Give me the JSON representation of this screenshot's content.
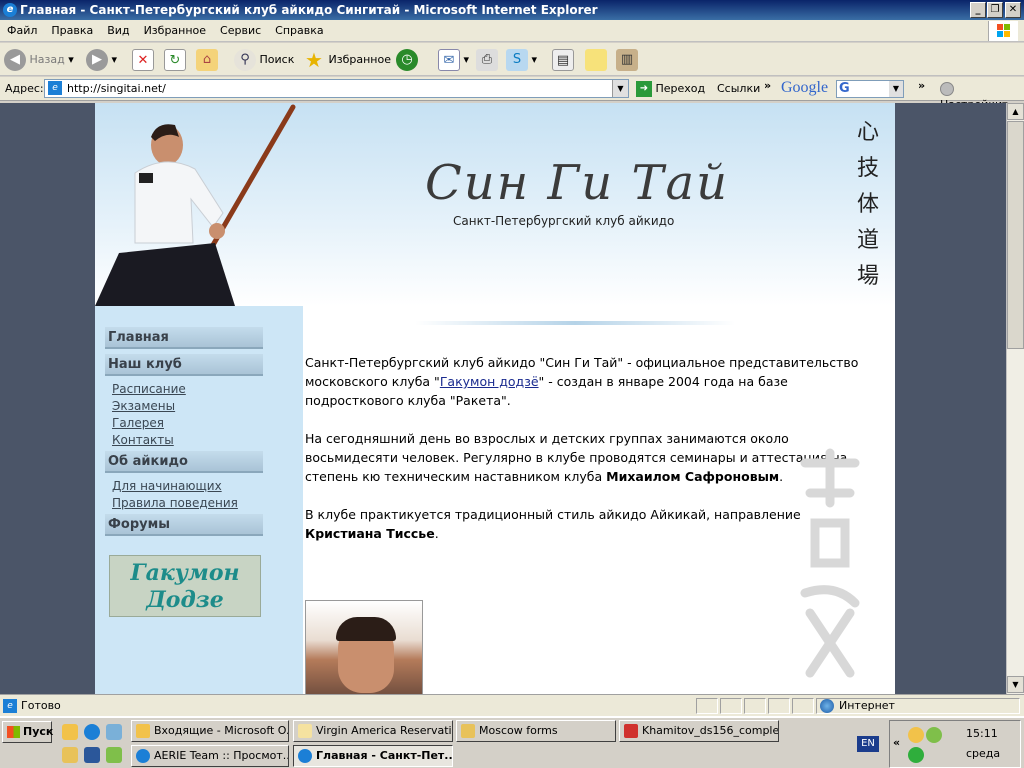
{
  "window": {
    "title": "Главная - Санкт-Петербургский клуб айкидо Сингитай - Microsoft Internet Explorer"
  },
  "menu": [
    "Файл",
    "Правка",
    "Вид",
    "Избранное",
    "Сервис",
    "Справка"
  ],
  "toolbar": {
    "back": "Назад",
    "search": "Поиск",
    "favorites": "Избранное"
  },
  "address": {
    "label": "Адрес:",
    "url": "http://singitai.net/",
    "go": "Переход",
    "links": "Ссылки",
    "google": "Google",
    "settings": "Настройки"
  },
  "site": {
    "logo": "Син Ги Тай",
    "subtitle": "Санкт-Петербургский клуб айкидо",
    "kanji": [
      "心",
      "技",
      "体",
      "道",
      "場"
    ],
    "nav": {
      "home": "Главная",
      "club": "Наш клуб",
      "club_links": [
        "Расписание",
        "Экзамены",
        "Галерея",
        "Контакты"
      ],
      "aikido": "Об айкидо",
      "aikido_links": [
        "Для начинающих",
        "Правила поведения"
      ],
      "forums": "Форумы"
    },
    "banner": [
      "Гакумон",
      "Додзе"
    ],
    "content": {
      "p1_a": "Санкт-Петербургский клуб айкидо \"Син Ги Тай\" - официальное представительство московского клуба \"",
      "p1_link": "Гакумон додзё",
      "p1_b": "\" - создан в январе 2004 года на базе подросткового клуба \"Ракета\".",
      "p2_a": "На сегодняшний день во взрослых и детских группах занимаются около восьмидесяти человек. Регулярно в клубе проводятся семинары и аттестация на степень кю техническим наставником клуба ",
      "p2_b": "Михаилом Сафроновым",
      "p2_c": ".",
      "p3_a": "В клубе практикуется традиционный стиль айкидо Айкикай, направление ",
      "p3_b": "Кристиана Тиссье",
      "p3_c": "."
    }
  },
  "status": {
    "text": "Готово",
    "zone": "Интернет"
  },
  "taskbar": {
    "start": "Пуск",
    "tasks": [
      "Входящие - Microsoft O...",
      "Virgin America Reservati...",
      "Moscow forms",
      "Khamitov_ds156_comple...",
      "AERIE Team :: Просмот...",
      "Главная - Санкт-Пет..."
    ],
    "lang": "EN",
    "time": "15:11",
    "day": "среда"
  }
}
